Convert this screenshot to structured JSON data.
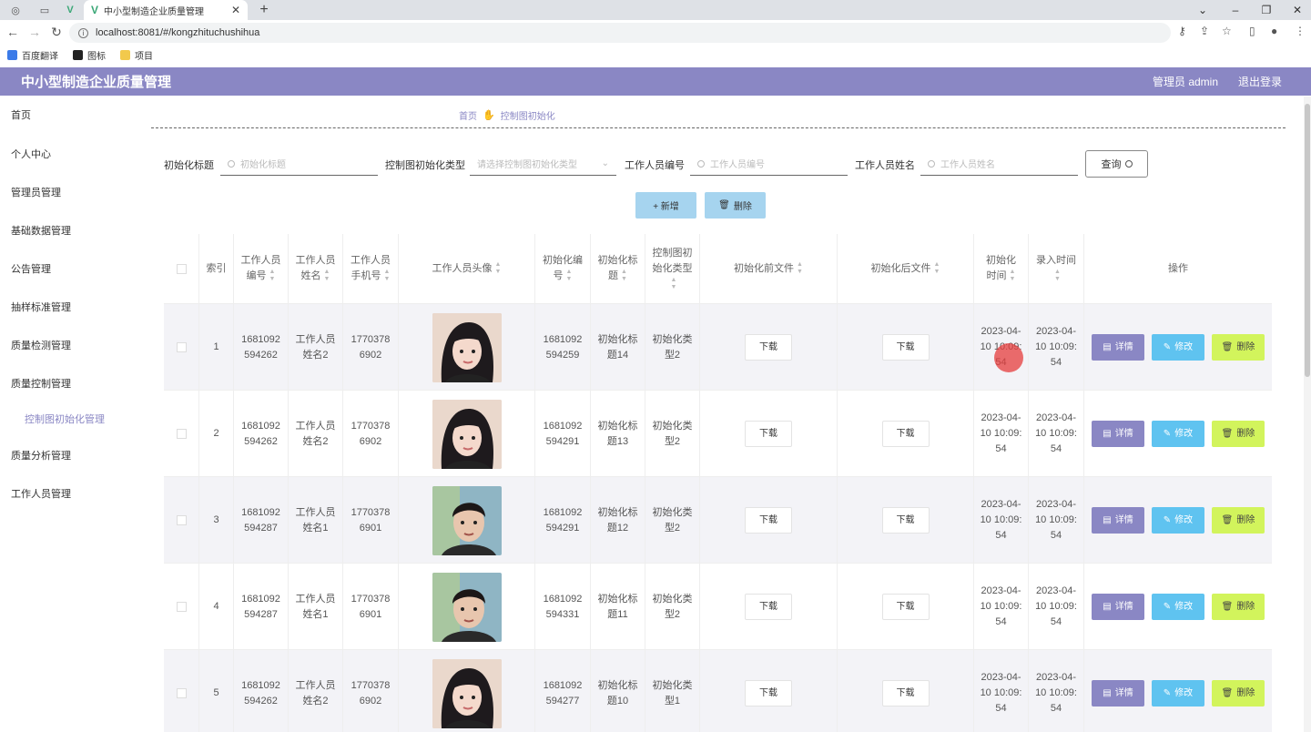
{
  "browser": {
    "tab_title": "中小型制造企业质量管理",
    "url": "localhost:8081/#/kongzhitu​chushihua",
    "bookmarks": [
      "百度翻译",
      "图标",
      "项目"
    ]
  },
  "header": {
    "brand": "中小型制造企业质量管理",
    "admin": "管理员 admin",
    "logout": "退出登录"
  },
  "sidebar": {
    "items": [
      "首页",
      "个人中心",
      "管理员管理",
      "基础数据管理",
      "公告管理",
      "抽样标准管理",
      "质量检测管理",
      "质量控制管理",
      "控制图初始化管理",
      "质量分析管理",
      "工作人员管理"
    ]
  },
  "breadcrumb": {
    "home": "首页",
    "current": "控制图初始化"
  },
  "filters": {
    "title_label": "初始化标题",
    "title_placeholder": "初始化标题",
    "type_label": "控制图初始化类型",
    "type_placeholder": "请选择控制图初始化类型",
    "worker_no_label": "工作人员编号",
    "worker_no_placeholder": "工作人员编号",
    "worker_name_label": "工作人员姓名",
    "worker_name_placeholder": "工作人员姓名",
    "query": "查询"
  },
  "actions": {
    "add": "+ 新增",
    "delete": "删除"
  },
  "table": {
    "headers": {
      "index": "索引",
      "worker_no": "工作人员编号",
      "worker_name": "工作人员姓名",
      "phone": "工作人员手机号",
      "avatar": "工作人员头像",
      "init_no": "初始化编号",
      "init_title": "初始化标题",
      "init_type": "控制图初始化类型",
      "before_file": "初始化前文件",
      "after_file": "初始化后文件",
      "init_time": "初始化时间",
      "entry_time": "录入时间",
      "ops": "操作"
    },
    "download_label": "下载",
    "detail_label": "详情",
    "edit_label": "修改",
    "remove_label": "删除",
    "rows": [
      {
        "index": "1",
        "worker_no": "1681092594262",
        "worker_name": "工作人员姓名2",
        "phone": "17703786902",
        "avatar": "female",
        "init_no": "1681092594259",
        "init_title": "初始化标题14",
        "init_type": "初始化类型2",
        "init_time": "2023-04-10 10:09:54",
        "entry_time": "2023-04-10 10:09:54"
      },
      {
        "index": "2",
        "worker_no": "1681092594262",
        "worker_name": "工作人员姓名2",
        "phone": "17703786902",
        "avatar": "female",
        "init_no": "1681092594291",
        "init_title": "初始化标题13",
        "init_type": "初始化类型2",
        "init_time": "2023-04-10 10:09:54",
        "entry_time": "2023-04-10 10:09:54"
      },
      {
        "index": "3",
        "worker_no": "1681092594287",
        "worker_name": "工作人员姓名1",
        "phone": "17703786901",
        "avatar": "male",
        "init_no": "1681092594291",
        "init_title": "初始化标题12",
        "init_type": "初始化类型2",
        "init_time": "2023-04-10 10:09:54",
        "entry_time": "2023-04-10 10:09:54"
      },
      {
        "index": "4",
        "worker_no": "1681092594287",
        "worker_name": "工作人员姓名1",
        "phone": "17703786901",
        "avatar": "male",
        "init_no": "1681092594331",
        "init_title": "初始化标题11",
        "init_type": "初始化类型2",
        "init_time": "2023-04-10 10:09:54",
        "entry_time": "2023-04-10 10:09:54"
      },
      {
        "index": "5",
        "worker_no": "1681092594262",
        "worker_name": "工作人员姓名2",
        "phone": "17703786902",
        "avatar": "female",
        "init_no": "1681092594277",
        "init_title": "初始化标题10",
        "init_type": "初始化类型1",
        "init_time": "2023-04-10 10:09:54",
        "entry_time": "2023-04-10 10:09:54"
      }
    ]
  },
  "colors": {
    "accent": "#8a87c4",
    "edit": "#5fc3f0",
    "remove": "#d2f45c",
    "primary_light": "#a6d4ef"
  }
}
